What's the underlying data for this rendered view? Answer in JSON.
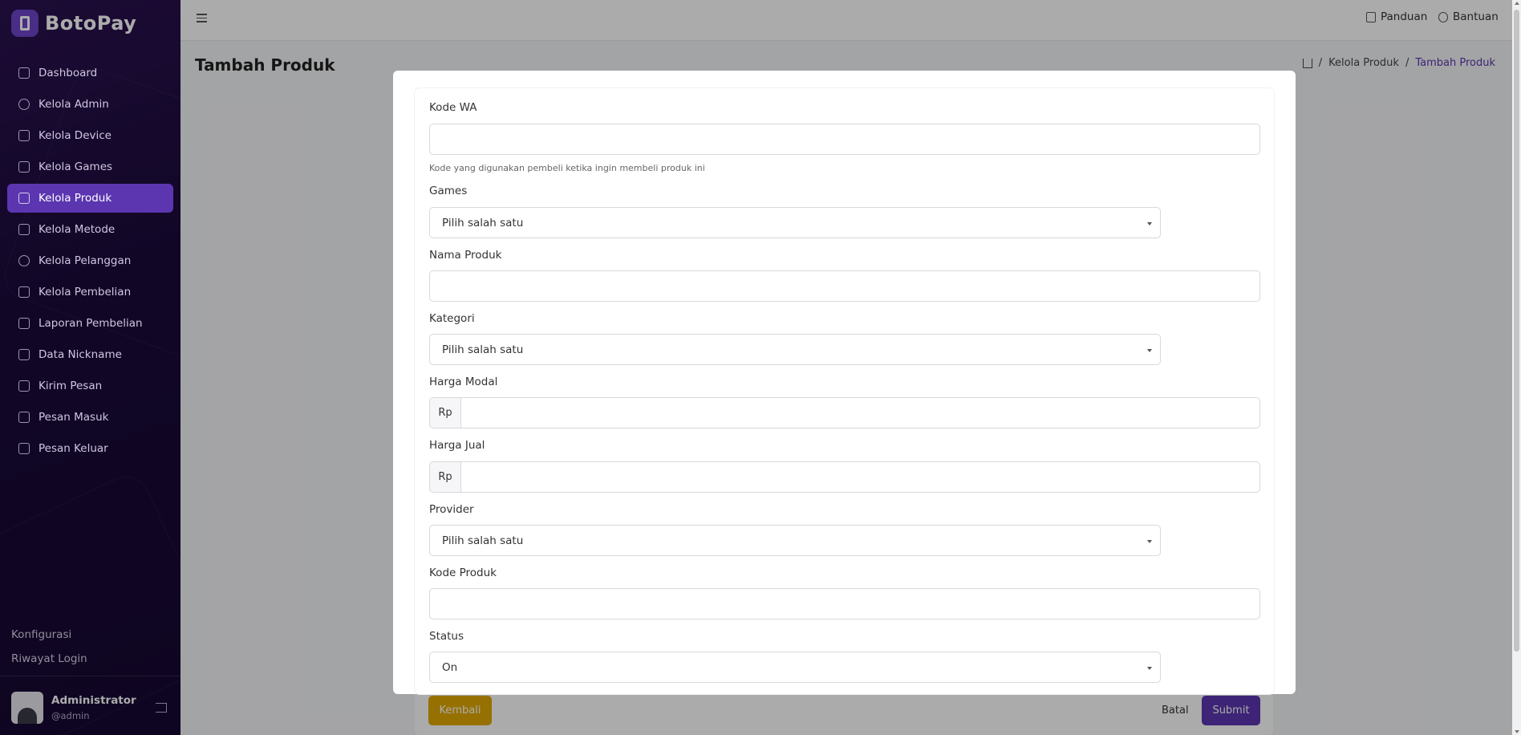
{
  "brand": {
    "name": "BotoPay"
  },
  "sidebar": {
    "items": [
      {
        "label": "Dashboard",
        "icon": "home-icon"
      },
      {
        "label": "Kelola Admin",
        "icon": "user-icon"
      },
      {
        "label": "Kelola Device",
        "icon": "devices-icon"
      },
      {
        "label": "Kelola Games",
        "icon": "gamepad-icon"
      },
      {
        "label": "Kelola Produk",
        "icon": "box-icon",
        "active": true
      },
      {
        "label": "Kelola Metode",
        "icon": "card-icon"
      },
      {
        "label": "Kelola Pelanggan",
        "icon": "users-icon"
      },
      {
        "label": "Kelola Pembelian",
        "icon": "cart-icon"
      },
      {
        "label": "Laporan Pembelian",
        "icon": "file-icon"
      },
      {
        "label": "Data Nickname",
        "icon": "database-icon"
      },
      {
        "label": "Kirim Pesan",
        "icon": "send-icon"
      },
      {
        "label": "Pesan Masuk",
        "icon": "message-in-icon"
      },
      {
        "label": "Pesan Keluar",
        "icon": "message-out-icon"
      }
    ],
    "bottom": {
      "config": "Konfigurasi",
      "login_history": "Riwayat Login"
    },
    "user": {
      "name": "Administrator",
      "handle": "@admin"
    }
  },
  "topbar": {
    "guide": "Panduan",
    "help": "Bantuan"
  },
  "page": {
    "title": "Tambah Produk",
    "breadcrumb": {
      "parent": "Kelola Produk",
      "current": "Tambah Produk"
    }
  },
  "form": {
    "kode_wa": {
      "label": "Kode WA",
      "value": "",
      "help": "Kode yang digunakan pembeli ketika ingin membeli produk ini"
    },
    "games": {
      "label": "Games",
      "value": "Pilih salah satu"
    },
    "nama_produk": {
      "label": "Nama Produk",
      "value": ""
    },
    "kategori": {
      "label": "Kategori",
      "value": "Pilih salah satu"
    },
    "harga_modal": {
      "label": "Harga Modal",
      "prefix": "Rp",
      "value": ""
    },
    "harga_jual": {
      "label": "Harga Jual",
      "prefix": "Rp",
      "value": ""
    },
    "provider": {
      "label": "Provider",
      "value": "Pilih salah satu"
    },
    "kode_produk": {
      "label": "Kode Produk",
      "value": ""
    },
    "status": {
      "label": "Status",
      "value": "On"
    }
  },
  "actions": {
    "back": "Kembali",
    "cancel": "Batal",
    "submit": "Submit"
  },
  "colors": {
    "accent": "#5b36b0",
    "warning": "#e0a800",
    "sidebar": "#1b0a3a"
  }
}
